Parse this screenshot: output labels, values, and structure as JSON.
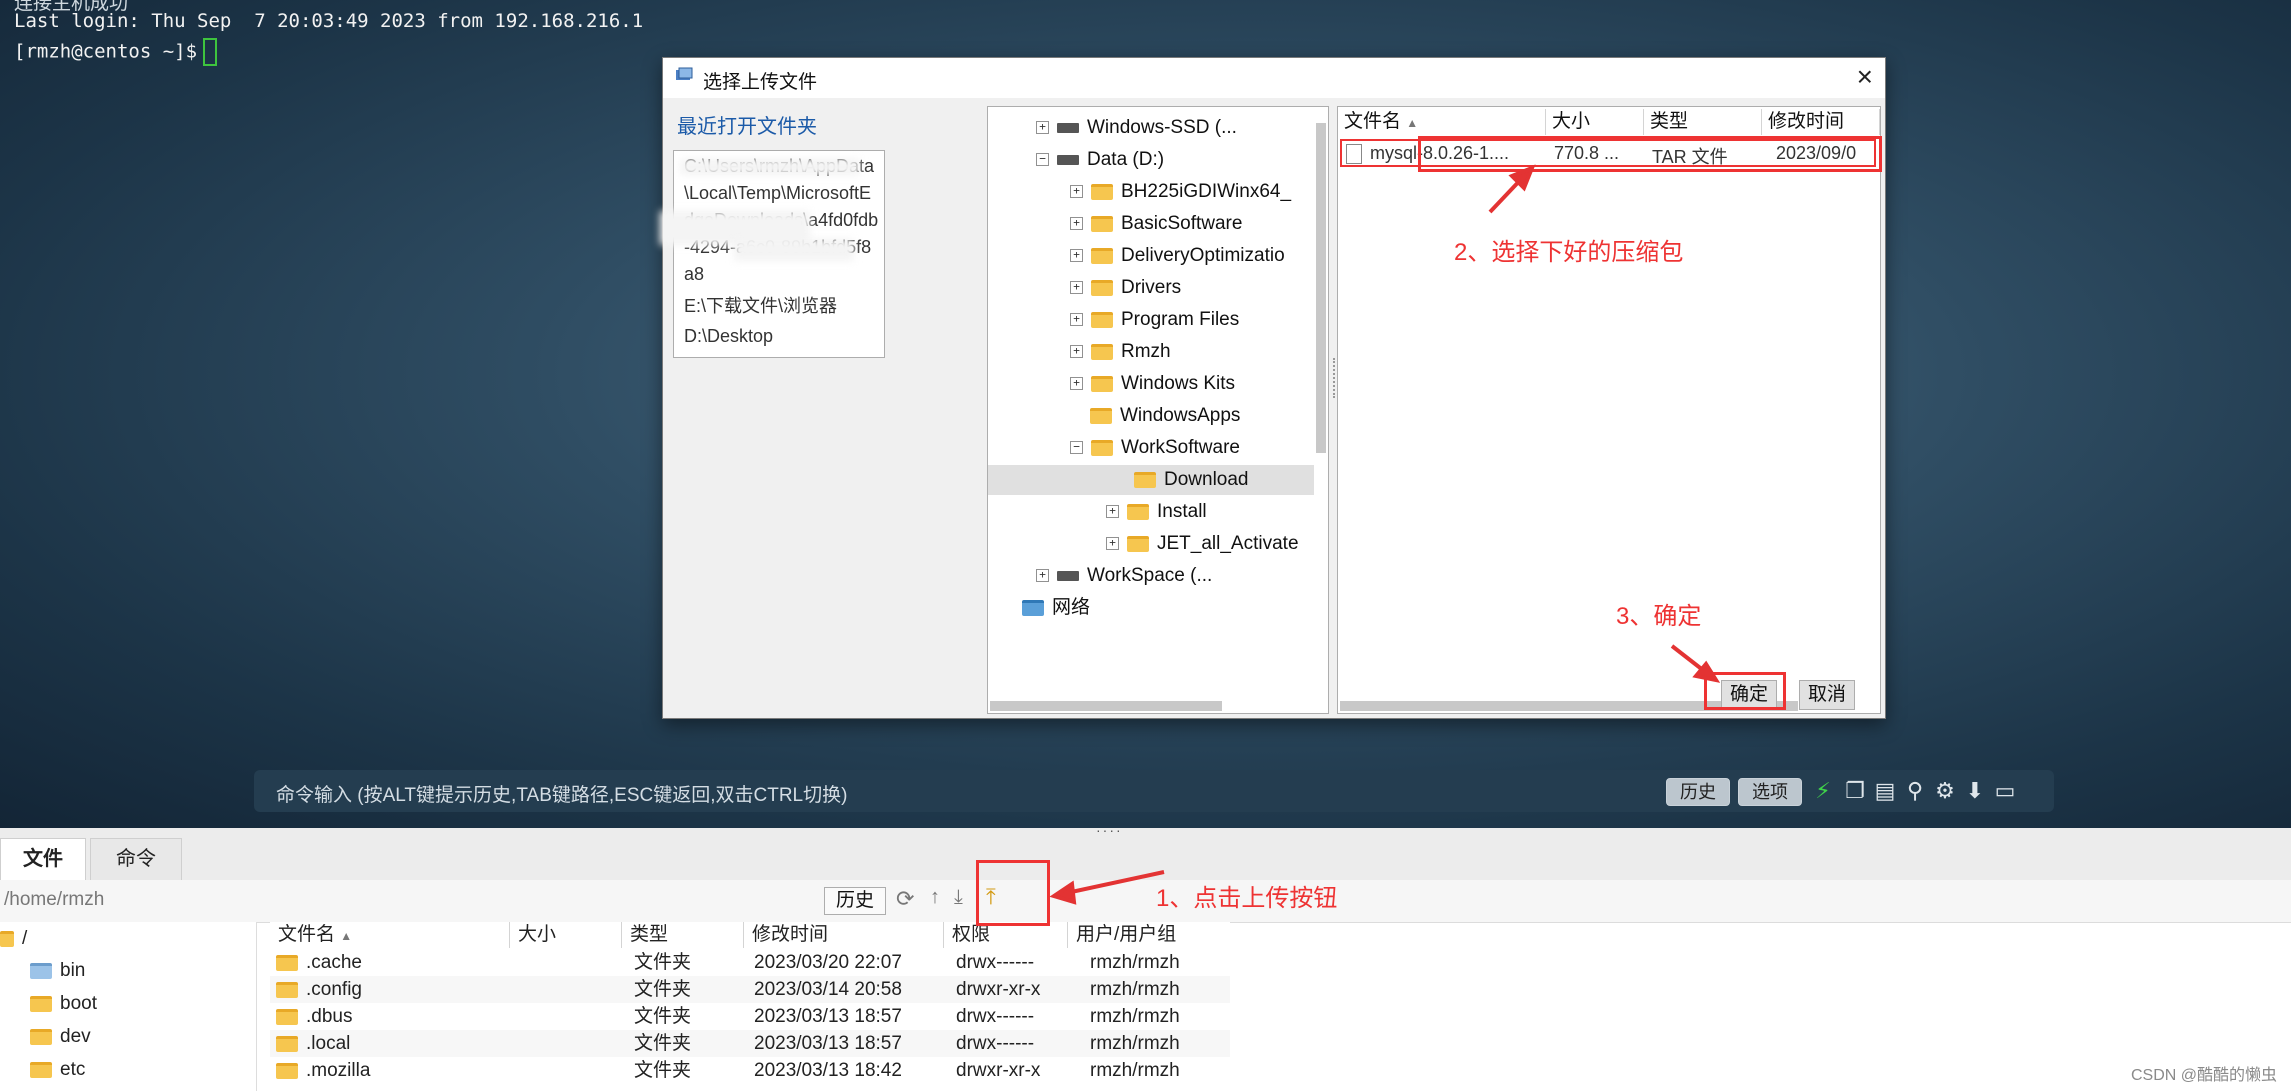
{
  "terminal": {
    "line0": "连接主机成功",
    "last_login": "Last login: Thu Sep  7 20:03:49 2023 from 192.168.216.1",
    "prompt": "[rmzh@centos ~]$"
  },
  "cmdbar": {
    "hint": "命令输入 (按ALT键提示历史,TAB键路径,ESC键返回,双击CTRL切换)",
    "history_label": "历史",
    "options_label": "选项"
  },
  "dialog": {
    "title": "选择上传文件",
    "recent_label": "最近打开文件夹",
    "recent_items": [
      "C:\\Users\\rmzh\\AppData\\Local\\Temp\\MicrosoftEdgeDownloads\\a4fd0fdb-4294-a6c0-89b1bfd5f8a8",
      "E:\\下载文件\\浏览器",
      "D:\\Desktop"
    ],
    "tree": [
      {
        "label": "Windows-SSD (...",
        "kind": "drive"
      },
      {
        "label": "Data (D:)",
        "kind": "drive"
      },
      {
        "label": "BH225iGDIWinx64_",
        "kind": "folder"
      },
      {
        "label": "BasicSoftware",
        "kind": "folder"
      },
      {
        "label": "DeliveryOptimizatio",
        "kind": "folder"
      },
      {
        "label": "Drivers",
        "kind": "folder"
      },
      {
        "label": "Program Files",
        "kind": "folder"
      },
      {
        "label": "Rmzh",
        "kind": "folder"
      },
      {
        "label": "Windows Kits",
        "kind": "folder"
      },
      {
        "label": "WindowsApps",
        "kind": "folder"
      },
      {
        "label": "WorkSoftware",
        "kind": "folder"
      },
      {
        "label": "Download",
        "kind": "folder"
      },
      {
        "label": "Install",
        "kind": "folder"
      },
      {
        "label": "JET_all_Activate",
        "kind": "folder"
      },
      {
        "label": "WorkSpace (...",
        "kind": "drive"
      },
      {
        "label": "网络",
        "kind": "network"
      }
    ],
    "file_columns": [
      "文件名",
      "大小",
      "类型",
      "修改时间"
    ],
    "file": {
      "name": "mysql-8.0.26-1....",
      "size": "770.8 ...",
      "type": "TAR 文件",
      "mtime": "2023/09/0"
    },
    "ok_label": "确定",
    "cancel_label": "取消"
  },
  "annotations": {
    "step1": "1、点击上传按钮",
    "step2": "2、选择下好的压缩包",
    "step3": "3、确定"
  },
  "panel": {
    "tab_files": "文件",
    "tab_commands": "命令",
    "path": "/home/rmzh",
    "history_label": "历史",
    "tree": [
      "/",
      "bin",
      "boot",
      "dev",
      "etc"
    ],
    "columns": [
      "文件名",
      "大小",
      "类型",
      "修改时间",
      "权限",
      "用户/用户组"
    ],
    "rows": [
      {
        "name": ".cache",
        "size": "",
        "type": "文件夹",
        "mtime": "2023/03/20 22:07",
        "perm": "drwx------",
        "owner": "rmzh/rmzh"
      },
      {
        "name": ".config",
        "size": "",
        "type": "文件夹",
        "mtime": "2023/03/14 20:58",
        "perm": "drwxr-xr-x",
        "owner": "rmzh/rmzh"
      },
      {
        "name": ".dbus",
        "size": "",
        "type": "文件夹",
        "mtime": "2023/03/13 18:57",
        "perm": "drwx------",
        "owner": "rmzh/rmzh"
      },
      {
        "name": ".local",
        "size": "",
        "type": "文件夹",
        "mtime": "2023/03/13 18:57",
        "perm": "drwx------",
        "owner": "rmzh/rmzh"
      },
      {
        "name": ".mozilla",
        "size": "",
        "type": "文件夹",
        "mtime": "2023/03/13 18:42",
        "perm": "drwxr-xr-x",
        "owner": "rmzh/rmzh"
      }
    ]
  },
  "watermark": "CSDN @酷酷的懒虫",
  "colors": {
    "annotation": "#e33333",
    "terminal_bg": "#2f4d63",
    "accent_link": "#1b5aa8"
  }
}
